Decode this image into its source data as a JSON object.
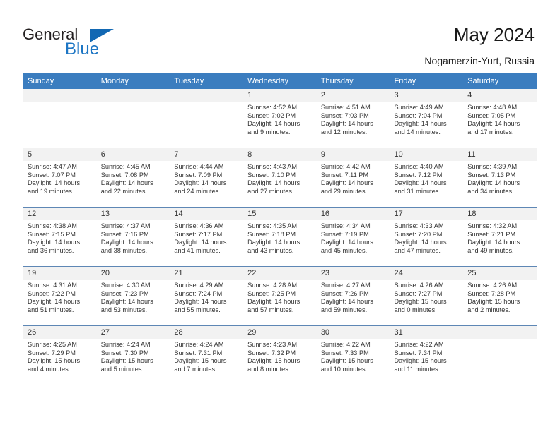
{
  "brand": {
    "name_part1": "General",
    "name_part2": "Blue",
    "accent_color": "#1d76c4",
    "header_color": "#3b7dbf"
  },
  "header": {
    "title": "May 2024",
    "location": "Nogamerzin-Yurt, Russia"
  },
  "weekdays": [
    "Sunday",
    "Monday",
    "Tuesday",
    "Wednesday",
    "Thursday",
    "Friday",
    "Saturday"
  ],
  "weeks": [
    [
      {
        "day": "",
        "sunrise": "",
        "sunset": "",
        "daylight_line1": "",
        "daylight_line2": "",
        "blank": true
      },
      {
        "day": "",
        "sunrise": "",
        "sunset": "",
        "daylight_line1": "",
        "daylight_line2": "",
        "blank": true
      },
      {
        "day": "",
        "sunrise": "",
        "sunset": "",
        "daylight_line1": "",
        "daylight_line2": "",
        "blank": true
      },
      {
        "day": "1",
        "sunrise": "Sunrise: 4:52 AM",
        "sunset": "Sunset: 7:02 PM",
        "daylight_line1": "Daylight: 14 hours",
        "daylight_line2": "and 9 minutes."
      },
      {
        "day": "2",
        "sunrise": "Sunrise: 4:51 AM",
        "sunset": "Sunset: 7:03 PM",
        "daylight_line1": "Daylight: 14 hours",
        "daylight_line2": "and 12 minutes."
      },
      {
        "day": "3",
        "sunrise": "Sunrise: 4:49 AM",
        "sunset": "Sunset: 7:04 PM",
        "daylight_line1": "Daylight: 14 hours",
        "daylight_line2": "and 14 minutes."
      },
      {
        "day": "4",
        "sunrise": "Sunrise: 4:48 AM",
        "sunset": "Sunset: 7:05 PM",
        "daylight_line1": "Daylight: 14 hours",
        "daylight_line2": "and 17 minutes."
      }
    ],
    [
      {
        "day": "5",
        "sunrise": "Sunrise: 4:47 AM",
        "sunset": "Sunset: 7:07 PM",
        "daylight_line1": "Daylight: 14 hours",
        "daylight_line2": "and 19 minutes."
      },
      {
        "day": "6",
        "sunrise": "Sunrise: 4:45 AM",
        "sunset": "Sunset: 7:08 PM",
        "daylight_line1": "Daylight: 14 hours",
        "daylight_line2": "and 22 minutes."
      },
      {
        "day": "7",
        "sunrise": "Sunrise: 4:44 AM",
        "sunset": "Sunset: 7:09 PM",
        "daylight_line1": "Daylight: 14 hours",
        "daylight_line2": "and 24 minutes."
      },
      {
        "day": "8",
        "sunrise": "Sunrise: 4:43 AM",
        "sunset": "Sunset: 7:10 PM",
        "daylight_line1": "Daylight: 14 hours",
        "daylight_line2": "and 27 minutes."
      },
      {
        "day": "9",
        "sunrise": "Sunrise: 4:42 AM",
        "sunset": "Sunset: 7:11 PM",
        "daylight_line1": "Daylight: 14 hours",
        "daylight_line2": "and 29 minutes."
      },
      {
        "day": "10",
        "sunrise": "Sunrise: 4:40 AM",
        "sunset": "Sunset: 7:12 PM",
        "daylight_line1": "Daylight: 14 hours",
        "daylight_line2": "and 31 minutes."
      },
      {
        "day": "11",
        "sunrise": "Sunrise: 4:39 AM",
        "sunset": "Sunset: 7:13 PM",
        "daylight_line1": "Daylight: 14 hours",
        "daylight_line2": "and 34 minutes."
      }
    ],
    [
      {
        "day": "12",
        "sunrise": "Sunrise: 4:38 AM",
        "sunset": "Sunset: 7:15 PM",
        "daylight_line1": "Daylight: 14 hours",
        "daylight_line2": "and 36 minutes."
      },
      {
        "day": "13",
        "sunrise": "Sunrise: 4:37 AM",
        "sunset": "Sunset: 7:16 PM",
        "daylight_line1": "Daylight: 14 hours",
        "daylight_line2": "and 38 minutes."
      },
      {
        "day": "14",
        "sunrise": "Sunrise: 4:36 AM",
        "sunset": "Sunset: 7:17 PM",
        "daylight_line1": "Daylight: 14 hours",
        "daylight_line2": "and 41 minutes."
      },
      {
        "day": "15",
        "sunrise": "Sunrise: 4:35 AM",
        "sunset": "Sunset: 7:18 PM",
        "daylight_line1": "Daylight: 14 hours",
        "daylight_line2": "and 43 minutes."
      },
      {
        "day": "16",
        "sunrise": "Sunrise: 4:34 AM",
        "sunset": "Sunset: 7:19 PM",
        "daylight_line1": "Daylight: 14 hours",
        "daylight_line2": "and 45 minutes."
      },
      {
        "day": "17",
        "sunrise": "Sunrise: 4:33 AM",
        "sunset": "Sunset: 7:20 PM",
        "daylight_line1": "Daylight: 14 hours",
        "daylight_line2": "and 47 minutes."
      },
      {
        "day": "18",
        "sunrise": "Sunrise: 4:32 AM",
        "sunset": "Sunset: 7:21 PM",
        "daylight_line1": "Daylight: 14 hours",
        "daylight_line2": "and 49 minutes."
      }
    ],
    [
      {
        "day": "19",
        "sunrise": "Sunrise: 4:31 AM",
        "sunset": "Sunset: 7:22 PM",
        "daylight_line1": "Daylight: 14 hours",
        "daylight_line2": "and 51 minutes."
      },
      {
        "day": "20",
        "sunrise": "Sunrise: 4:30 AM",
        "sunset": "Sunset: 7:23 PM",
        "daylight_line1": "Daylight: 14 hours",
        "daylight_line2": "and 53 minutes."
      },
      {
        "day": "21",
        "sunrise": "Sunrise: 4:29 AM",
        "sunset": "Sunset: 7:24 PM",
        "daylight_line1": "Daylight: 14 hours",
        "daylight_line2": "and 55 minutes."
      },
      {
        "day": "22",
        "sunrise": "Sunrise: 4:28 AM",
        "sunset": "Sunset: 7:25 PM",
        "daylight_line1": "Daylight: 14 hours",
        "daylight_line2": "and 57 minutes."
      },
      {
        "day": "23",
        "sunrise": "Sunrise: 4:27 AM",
        "sunset": "Sunset: 7:26 PM",
        "daylight_line1": "Daylight: 14 hours",
        "daylight_line2": "and 59 minutes."
      },
      {
        "day": "24",
        "sunrise": "Sunrise: 4:26 AM",
        "sunset": "Sunset: 7:27 PM",
        "daylight_line1": "Daylight: 15 hours",
        "daylight_line2": "and 0 minutes."
      },
      {
        "day": "25",
        "sunrise": "Sunrise: 4:26 AM",
        "sunset": "Sunset: 7:28 PM",
        "daylight_line1": "Daylight: 15 hours",
        "daylight_line2": "and 2 minutes."
      }
    ],
    [
      {
        "day": "26",
        "sunrise": "Sunrise: 4:25 AM",
        "sunset": "Sunset: 7:29 PM",
        "daylight_line1": "Daylight: 15 hours",
        "daylight_line2": "and 4 minutes."
      },
      {
        "day": "27",
        "sunrise": "Sunrise: 4:24 AM",
        "sunset": "Sunset: 7:30 PM",
        "daylight_line1": "Daylight: 15 hours",
        "daylight_line2": "and 5 minutes."
      },
      {
        "day": "28",
        "sunrise": "Sunrise: 4:24 AM",
        "sunset": "Sunset: 7:31 PM",
        "daylight_line1": "Daylight: 15 hours",
        "daylight_line2": "and 7 minutes."
      },
      {
        "day": "29",
        "sunrise": "Sunrise: 4:23 AM",
        "sunset": "Sunset: 7:32 PM",
        "daylight_line1": "Daylight: 15 hours",
        "daylight_line2": "and 8 minutes."
      },
      {
        "day": "30",
        "sunrise": "Sunrise: 4:22 AM",
        "sunset": "Sunset: 7:33 PM",
        "daylight_line1": "Daylight: 15 hours",
        "daylight_line2": "and 10 minutes."
      },
      {
        "day": "31",
        "sunrise": "Sunrise: 4:22 AM",
        "sunset": "Sunset: 7:34 PM",
        "daylight_line1": "Daylight: 15 hours",
        "daylight_line2": "and 11 minutes."
      },
      {
        "day": "",
        "sunrise": "",
        "sunset": "",
        "daylight_line1": "",
        "daylight_line2": "",
        "blank": true
      }
    ]
  ]
}
